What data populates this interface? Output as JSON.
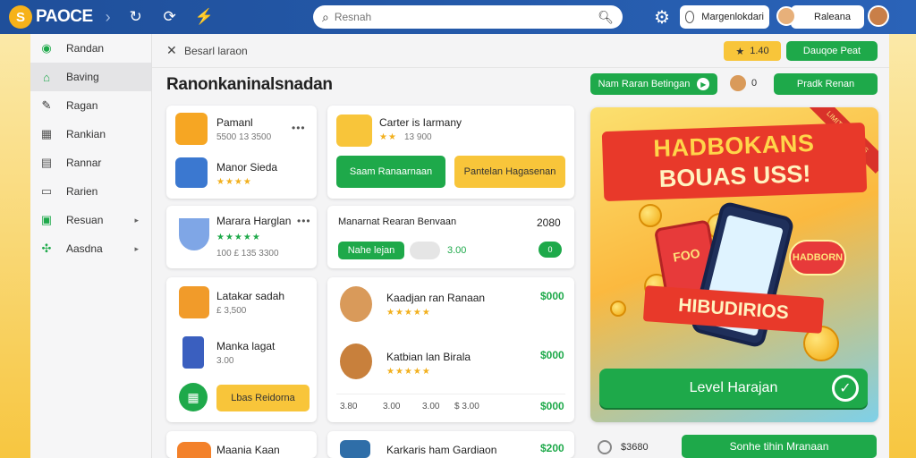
{
  "app": {
    "logo_letter": "S",
    "name": "PAOCE"
  },
  "topbar": {
    "search_placeholder": "Resnah",
    "notif_label": "Margenlokdari",
    "user_name": "Raleana"
  },
  "sidebar": {
    "items": [
      {
        "label": "Randan",
        "icon": "circle-check-icon",
        "active": false,
        "caret": false
      },
      {
        "label": "Baving",
        "icon": "home-icon",
        "active": true,
        "caret": false
      },
      {
        "label": "Ragan",
        "icon": "pencil-icon",
        "active": false,
        "caret": false
      },
      {
        "label": "Rankian",
        "icon": "calendar-icon",
        "active": false,
        "caret": false
      },
      {
        "label": "Rannar",
        "icon": "chart-icon",
        "active": false,
        "caret": false
      },
      {
        "label": "Rarien",
        "icon": "folder-icon",
        "active": false,
        "caret": false
      },
      {
        "label": "Resuan",
        "icon": "grid-icon",
        "active": false,
        "caret": true
      },
      {
        "label": "Aasdna",
        "icon": "puzzle-icon",
        "active": false,
        "caret": true
      }
    ]
  },
  "main": {
    "breadcrumb": "Besarl laraon",
    "coin_balance": "1.40",
    "header_button": "Dauqoe Peat",
    "page_title": "Ranonkaninalsnadan",
    "secondary_button": "Nam Raran Betingan",
    "count_label": "0",
    "right_button": "Pradk Renan"
  },
  "left_cards": [
    {
      "rows": [
        {
          "title": "Pamanl",
          "sub": "5500 13 3500",
          "thumb": "#f6a623"
        },
        {
          "title": "Manor Sieda",
          "stars": "★★★★",
          "thumb": "#3b78d0"
        }
      ]
    },
    {
      "rows": [
        {
          "title": "Marara Harglan",
          "stars": "★★★★★",
          "sub": "100 £ 135 3300",
          "thumb": "#7fa6e6"
        }
      ]
    },
    {
      "rows": [
        {
          "title": "Latakar sadah",
          "sub": "£ 3,500",
          "thumb": "#f19b2a"
        },
        {
          "title": "Manka lagat",
          "sub": "3.00",
          "thumb": "#3a5fbf"
        }
      ],
      "button": "Lbas Reidorna"
    },
    {
      "rows": [
        {
          "title": "Maania Kaan",
          "thumb": "#f3812a"
        }
      ]
    }
  ],
  "mid_cards": [
    {
      "title": "Carter is Iarmany",
      "stars": "★★",
      "sub": "13 900",
      "btn_green": "Saam Ranaarnaan",
      "btn_yellow": "Pantelan Hagasenan"
    },
    {
      "title": "Manarnat Rearan Benvaan",
      "amount": "2080",
      "pill": "Nahe lejan",
      "pill_value": "3.00",
      "toggle_count": "0"
    },
    {
      "rows": [
        {
          "title": "Kaadjan ran Ranaan",
          "price": "$000"
        },
        {
          "title": "Katbian lan Birala",
          "stars": "★★★★★",
          "price": "$000"
        }
      ],
      "footer": [
        "3.80",
        "3.00",
        "3.00",
        "$ 3.00"
      ],
      "footer_price": "$000"
    },
    {
      "rows": [
        {
          "title": "Karkaris ham Gardiaon",
          "price": "$200"
        }
      ]
    }
  ],
  "promo": {
    "headline1": "HADBOKANS",
    "headline2": "BOUAS USS!",
    "corner_tag": "LIMITED BONUS",
    "slot_text": "FOO",
    "round_badge": "HADBORN",
    "subhead": "HIBUDIRIOS",
    "cta": "Level Harajan"
  },
  "bottom": {
    "label": "$3680",
    "button": "Sonhe tihin Mranaan"
  },
  "colors": {
    "primary_blue": "#2a63b8",
    "accent_green": "#1ea94a",
    "accent_yellow": "#f8c53a",
    "promo_red": "#e8392a"
  }
}
